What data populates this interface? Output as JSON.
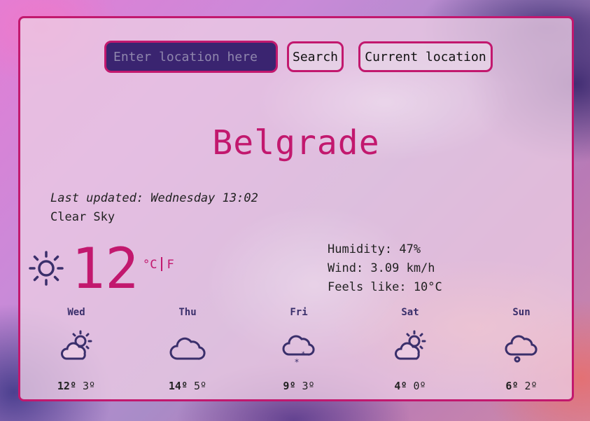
{
  "search": {
    "placeholder": "Enter location here",
    "search_label": "Search",
    "current_label": "Current location"
  },
  "city": "Belgrade",
  "last_updated": "Last updated: Wednesday 13:02",
  "description": "Clear Sky",
  "temperature": "12",
  "units": {
    "celsius": "°C",
    "fahrenheit": "F"
  },
  "details": {
    "humidity": "Humidity: 47%",
    "wind": "Wind: 3.09 km/h",
    "feels_like": "Feels like: 10°C"
  },
  "icons": {
    "current": "sun-icon"
  },
  "colors": {
    "accent": "#c2186e",
    "icon": "#3a2f6b",
    "input_bg": "#3a2470"
  },
  "forecast": [
    {
      "day": "Wed",
      "max": "12º",
      "min": "3º",
      "icon": "partly-cloudy-icon"
    },
    {
      "day": "Thu",
      "max": "14º",
      "min": "5º",
      "icon": "cloud-icon"
    },
    {
      "day": "Fri",
      "max": "9º",
      "min": "3º",
      "icon": "snow-icon"
    },
    {
      "day": "Sat",
      "max": "4º",
      "min": "0º",
      "icon": "partly-cloudy-icon"
    },
    {
      "day": "Sun",
      "max": "6º",
      "min": "2º",
      "icon": "cloudy-icon"
    }
  ]
}
